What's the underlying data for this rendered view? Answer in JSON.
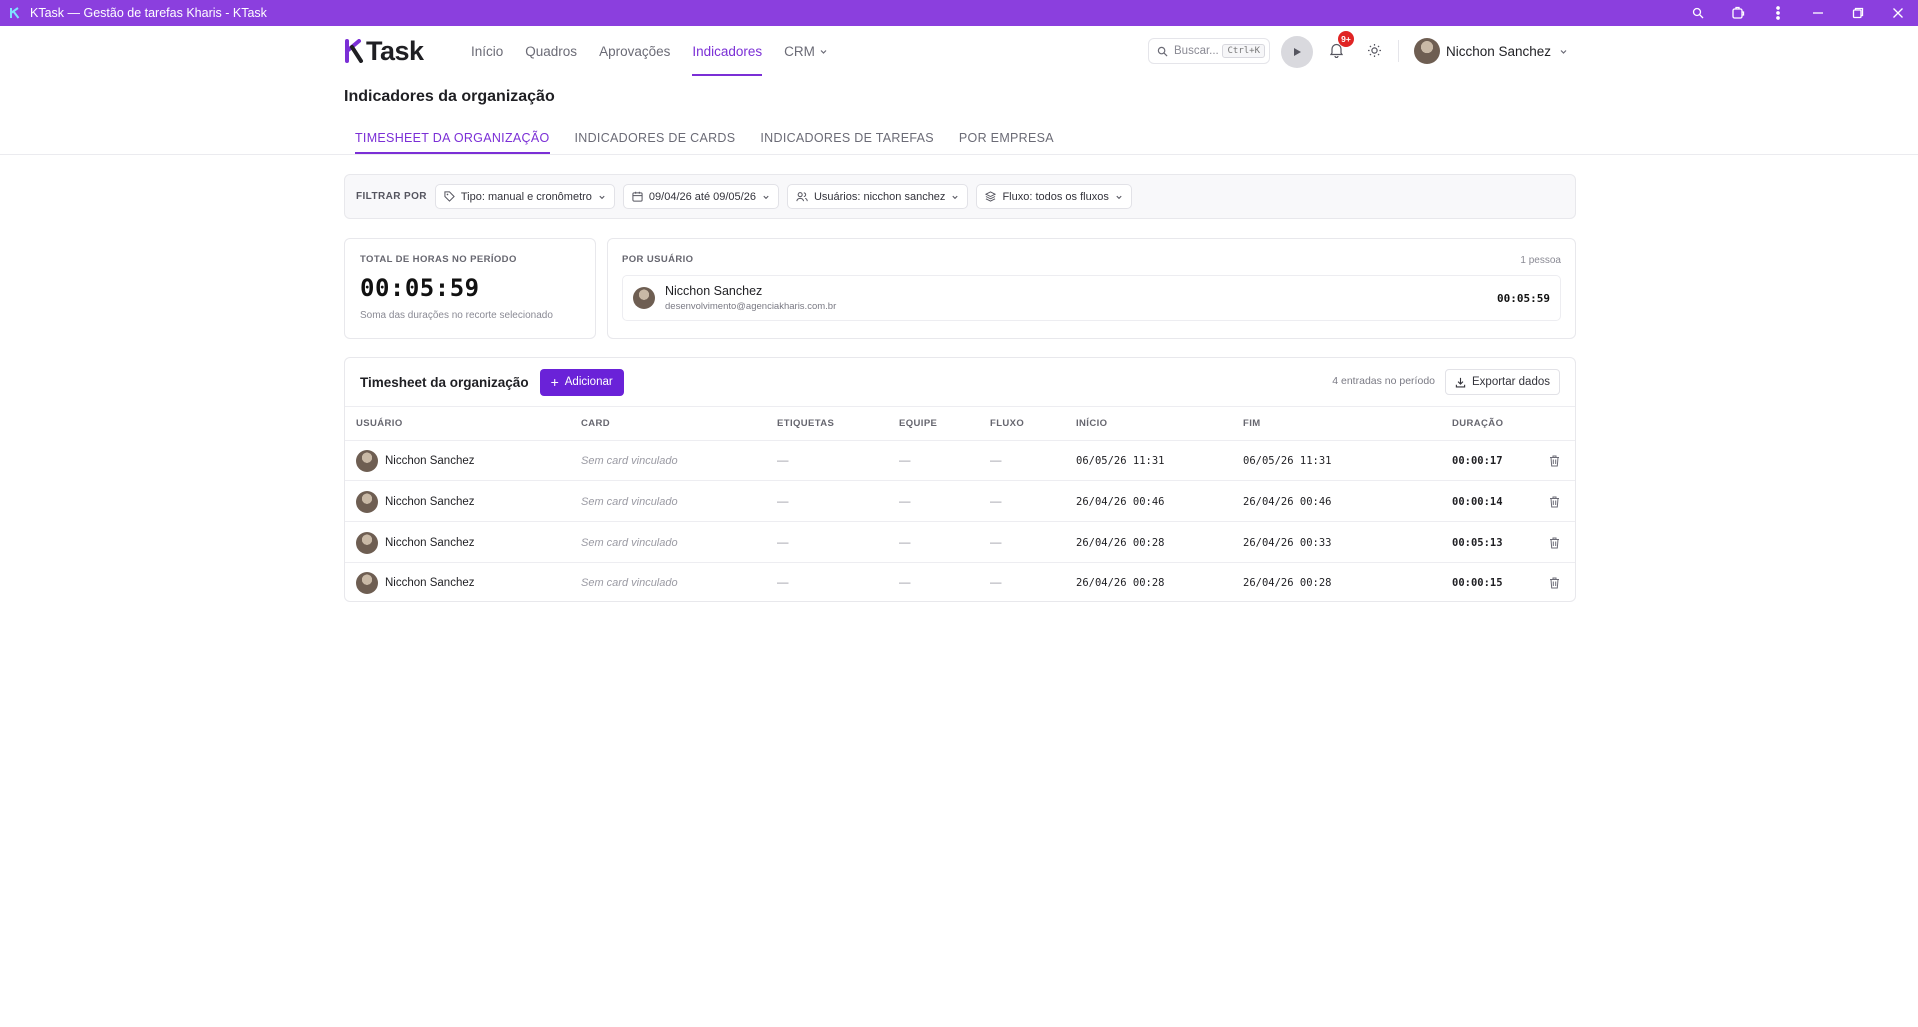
{
  "window": {
    "title": "KTask — Gestão de tarefas Kharis - KTask",
    "colors": {
      "titlebar": "#8b3fde",
      "accent": "#7b2fd6",
      "primary_button": "#6a22d8",
      "badge": "#e02424"
    }
  },
  "nav": {
    "brand": "Task",
    "links": [
      "Início",
      "Quadros",
      "Aprovações",
      "Indicadores",
      "CRM"
    ],
    "active_link": "Indicadores",
    "search_placeholder": "Buscar...",
    "search_shortcut": "Ctrl+K",
    "notifications_badge": "9+",
    "user_name": "Nicchon Sanchez"
  },
  "page": {
    "title": "Indicadores da organização",
    "tabs": [
      "TIMESHEET DA ORGANIZAÇÃO",
      "INDICADORES DE CARDS",
      "INDICADORES DE TAREFAS",
      "POR EMPRESA"
    ],
    "active_tab": "TIMESHEET DA ORGANIZAÇÃO"
  },
  "filters": {
    "label": "FILTRAR POR",
    "type": "Tipo: manual e cronômetro",
    "date_range": "09/04/26 até 09/05/26",
    "users": "Usuários: nicchon sanchez",
    "flow": "Fluxo: todos os fluxos"
  },
  "summary": {
    "total_label": "TOTAL DE HORAS NO PERÍODO",
    "total_value": "00:05:59",
    "total_help": "Soma das durações no recorte selecionado",
    "per_user_label": "POR USUÁRIO",
    "per_user_count": "1 pessoa",
    "per_user": [
      {
        "name": "Nicchon Sanchez",
        "email": "desenvolvimento@agenciakharis.com.br",
        "duration": "00:05:59"
      }
    ]
  },
  "timesheet": {
    "title": "Timesheet da organização",
    "add_label": "Adicionar",
    "entries_label": "4 entradas no período",
    "export_label": "Exportar dados",
    "columns": [
      "USUÁRIO",
      "CARD",
      "ETIQUETAS",
      "EQUIPE",
      "FLUXO",
      "INÍCIO",
      "FIM",
      "DURAÇÃO"
    ],
    "rows": [
      {
        "user": "Nicchon Sanchez",
        "card": "Sem card vinculado",
        "tags": "—",
        "team": "—",
        "flow": "—",
        "start": "06/05/26 11:31",
        "end": "06/05/26 11:31",
        "duration": "00:00:17"
      },
      {
        "user": "Nicchon Sanchez",
        "card": "Sem card vinculado",
        "tags": "—",
        "team": "—",
        "flow": "—",
        "start": "26/04/26 00:46",
        "end": "26/04/26 00:46",
        "duration": "00:00:14"
      },
      {
        "user": "Nicchon Sanchez",
        "card": "Sem card vinculado",
        "tags": "—",
        "team": "—",
        "flow": "—",
        "start": "26/04/26 00:28",
        "end": "26/04/26 00:33",
        "duration": "00:05:13"
      },
      {
        "user": "Nicchon Sanchez",
        "card": "Sem card vinculado",
        "tags": "—",
        "team": "—",
        "flow": "—",
        "start": "26/04/26 00:28",
        "end": "26/04/26 00:28",
        "duration": "00:00:15"
      }
    ]
  }
}
